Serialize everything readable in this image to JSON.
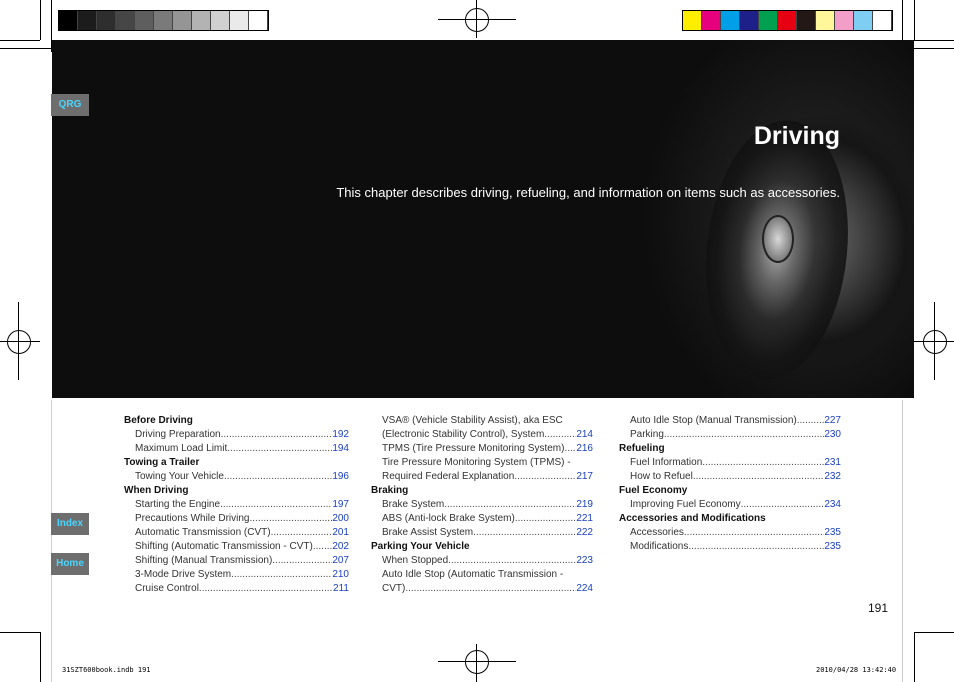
{
  "colors": {
    "grays": [
      "#000000",
      "#1c1c1c",
      "#2e2e2e",
      "#464646",
      "#5e5e5e",
      "#7a7a7a",
      "#959595",
      "#b3b3b3",
      "#d0d0d0",
      "#eaeaea",
      "#ffffff"
    ],
    "process": [
      "#ffee00",
      "#e6007e",
      "#00a0e9",
      "#1d2088",
      "#00a051",
      "#e60012",
      "#231815",
      "#fff799",
      "#f29ec8",
      "#7ecef4",
      "#ffffff"
    ],
    "link": "#1a3fbf",
    "side_button_text": "#4ad6ff"
  },
  "header": {
    "title": "Driving",
    "subtitle": "This chapter describes driving, refueling, and information on items such as accessories."
  },
  "nav": {
    "qrg": "QRG",
    "index": "Index",
    "home": "Home"
  },
  "toc": {
    "col1": [
      {
        "heading": "Before Driving",
        "items": [
          {
            "text": "Driving Preparation",
            "page": "192"
          },
          {
            "text": "Maximum Load Limit",
            "page": "194"
          }
        ]
      },
      {
        "heading": "Towing a Trailer",
        "items": [
          {
            "text": "Towing Your Vehicle",
            "page": "196"
          }
        ]
      },
      {
        "heading": "When Driving",
        "items": [
          {
            "text": "Starting the Engine",
            "page": "197"
          },
          {
            "text": "Precautions While Driving",
            "page": "200"
          },
          {
            "text": "Automatic Transmission (CVT)",
            "page": "201"
          },
          {
            "text": "Shifting (Automatic Transmission - CVT)",
            "page": "202"
          },
          {
            "text": "Shifting (Manual Transmission)",
            "page": "207"
          },
          {
            "text": "3-Mode Drive System",
            "page": "210"
          },
          {
            "text": "Cruise Control",
            "page": "211"
          }
        ]
      }
    ],
    "col2_top": [
      {
        "line1": "VSA® (Vehicle Stability Assist), aka ESC",
        "text": "(Electronic Stability Control), System",
        "page": "214"
      },
      {
        "text": "TPMS (Tire Pressure Monitoring System)",
        "page": "216"
      },
      {
        "line1": "Tire Pressure Monitoring System (TPMS) -",
        "text": "Required Federal Explanation",
        "page": "217"
      }
    ],
    "col2": [
      {
        "heading": "Braking",
        "items": [
          {
            "text": "Brake System",
            "page": "219"
          },
          {
            "text": "ABS (Anti-lock Brake System)",
            "page": "221"
          },
          {
            "text": "Brake Assist System",
            "page": "222"
          }
        ]
      },
      {
        "heading": "Parking Your Vehicle",
        "items": [
          {
            "text": "When Stopped",
            "page": "223"
          },
          {
            "line1": "Auto Idle Stop (Automatic Transmission -",
            "text": "CVT)",
            "page": "224"
          }
        ]
      }
    ],
    "col3_top": [
      {
        "text": "Auto Idle Stop (Manual Transmission)",
        "page": "227"
      },
      {
        "text": "Parking",
        "page": "230"
      }
    ],
    "col3": [
      {
        "heading": "Refueling",
        "items": [
          {
            "text": "Fuel Information",
            "page": "231"
          },
          {
            "text": "How to Refuel",
            "page": "232"
          }
        ]
      },
      {
        "heading": "Fuel Economy",
        "items": [
          {
            "text": "Improving Fuel Economy",
            "page": "234"
          }
        ]
      },
      {
        "heading": "Accessories and Modifications",
        "items": [
          {
            "text": "Accessories",
            "page": "235"
          },
          {
            "text": "Modifications",
            "page": "235"
          }
        ]
      }
    ]
  },
  "page_number": "191",
  "slug": {
    "file": "31SZT600book.indb   191",
    "datetime": "2010/04/28   13:42:40"
  }
}
